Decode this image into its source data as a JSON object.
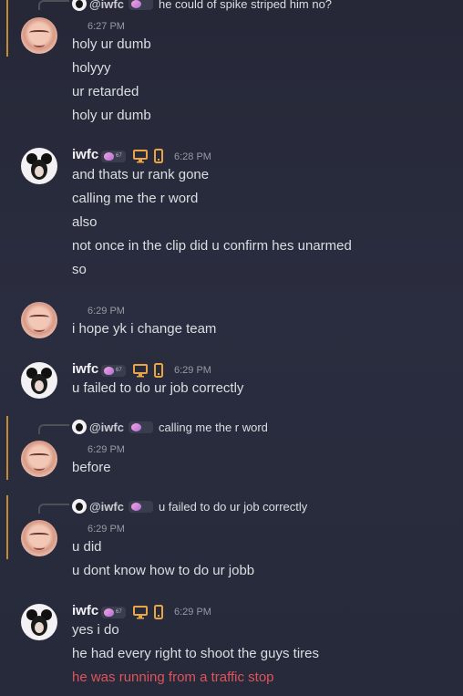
{
  "groups": [
    {
      "reply": {
        "author": "@iwfc",
        "text": "he could of spike striped him no?"
      },
      "time": "6:27 PM",
      "messages": [
        "holy ur dumb",
        "holyyy",
        "ur retarded",
        "holy ur dumb"
      ]
    },
    {
      "author": "iwfc",
      "time": "6:28 PM",
      "messages": [
        "and thats ur rank gone",
        "calling me the r word",
        "also",
        "not once in the clip did u confirm hes unarmed",
        "so"
      ]
    },
    {
      "time": "6:29 PM",
      "messages": [
        "i hope yk i change team"
      ]
    },
    {
      "author": "iwfc",
      "time": "6:29 PM",
      "messages": [
        "u failed to do ur job correctly"
      ]
    },
    {
      "reply": {
        "author": "@iwfc",
        "text": "calling me the r word"
      },
      "time": "6:29 PM",
      "messages": [
        "before"
      ]
    },
    {
      "reply": {
        "author": "@iwfc",
        "text": "u failed to do ur job correctly"
      },
      "time": "6:29 PM",
      "messages": [
        "u did",
        "u dont know how to do ur jobb"
      ]
    },
    {
      "author": "iwfc",
      "time": "6:29 PM",
      "messages": [
        "yes i do",
        "he had every right to shoot the guys tires",
        "he was running from a traffic stop"
      ]
    }
  ],
  "badge_level": "67",
  "colors": {
    "accent_bar": "#c38b33",
    "device_icons": "#e8a546",
    "error_text": "#e0535a"
  }
}
